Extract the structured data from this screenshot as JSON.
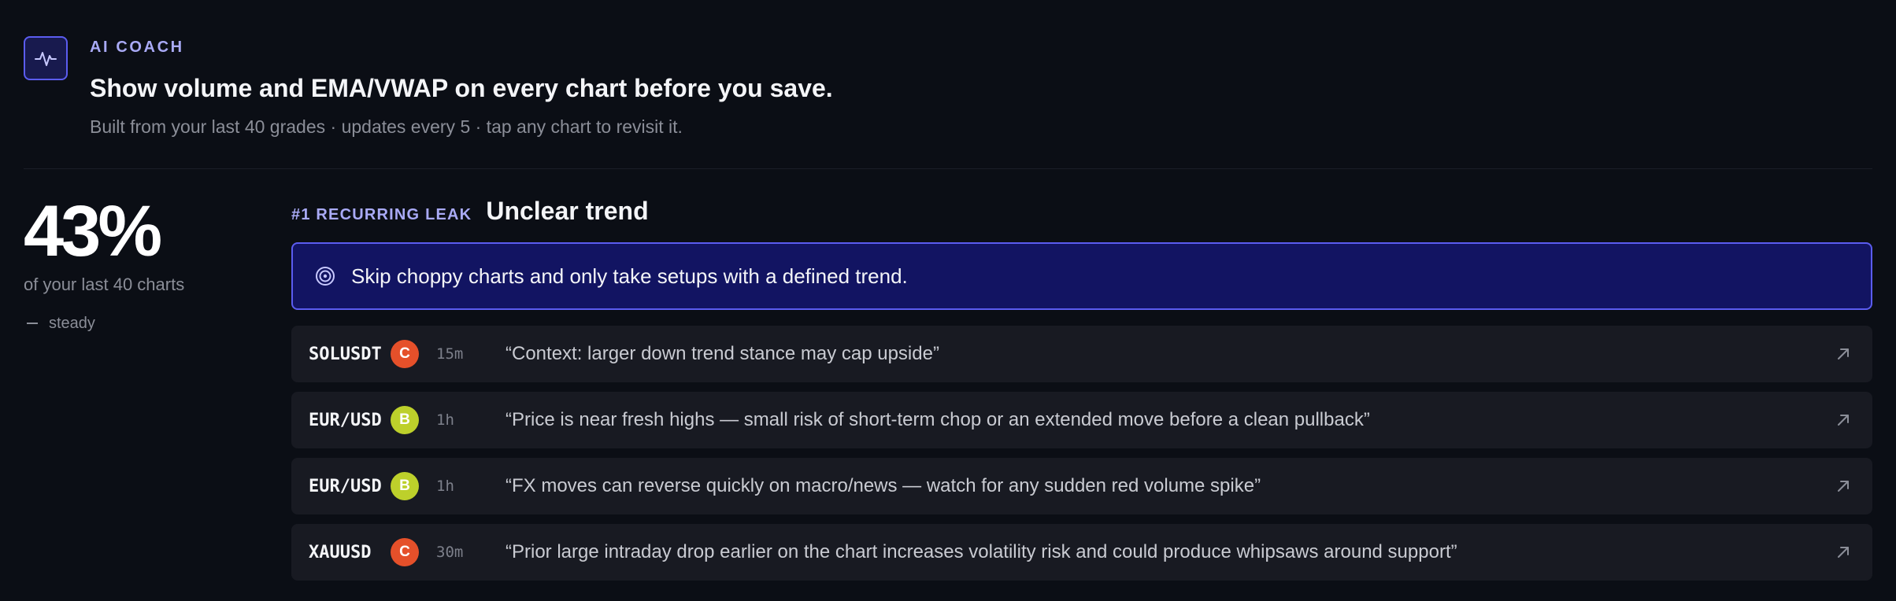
{
  "header": {
    "eyebrow": "AI COACH",
    "headline": "Show volume and EMA/VWAP on every chart before you save.",
    "subline": "Built from your last 40 grades · updates every 5 · tap any chart to revisit it.",
    "icon": "pulse-icon"
  },
  "stats": {
    "percent": "43%",
    "caption": "of your last 40 charts",
    "trend_label": "steady"
  },
  "leak": {
    "tag": "#1 RECURRING LEAK",
    "title": "Unclear trend",
    "tip_icon": "target-icon",
    "tip": "Skip choppy charts and only take setups with a defined trend."
  },
  "examples": [
    {
      "symbol": "SOLUSDT",
      "grade": "C",
      "timeframe": "15m",
      "quote": "“Context: larger down trend stance may cap upside”"
    },
    {
      "symbol": "EUR/USD",
      "grade": "B",
      "timeframe": "1h",
      "quote": "“Price is near fresh highs — small risk of short-term chop or an extended move before a clean pullback”"
    },
    {
      "symbol": "EUR/USD",
      "grade": "B",
      "timeframe": "1h",
      "quote": "“FX moves can reverse quickly on macro/news — watch for any sudden red volume spike”"
    },
    {
      "symbol": "XAUUSD",
      "grade": "C",
      "timeframe": "30m",
      "quote": "“Prior large intraday drop earlier on the chart increases volatility risk and could produce whipsaws around support”"
    }
  ],
  "colors": {
    "accent": "#5b5cf0",
    "accent_text": "#a9aaf6",
    "callout_bg": "#121462",
    "grade_C": "#e5502a",
    "grade_B": "#bdd02b",
    "card_bg": "#181a22",
    "page_bg": "#0b0e15"
  }
}
